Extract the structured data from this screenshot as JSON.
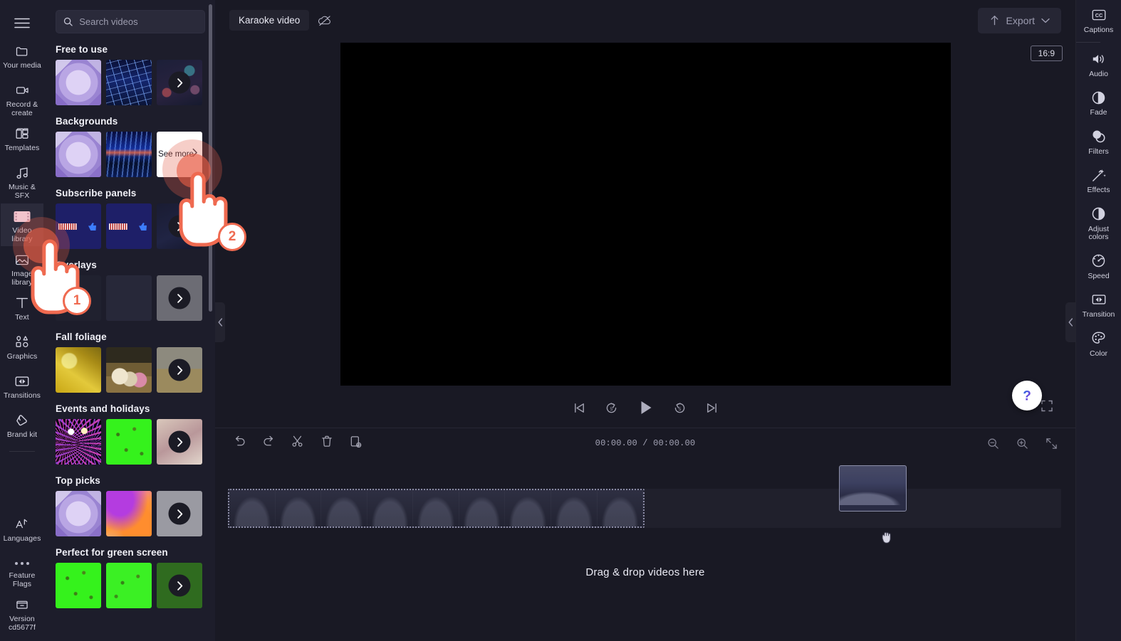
{
  "app": {
    "background_color": "#191924",
    "panel_color": "#1d1d2b",
    "accent_color": "#ef6a50"
  },
  "left_rail": {
    "hamburger_icon": "hamburger-menu-icon",
    "items": [
      {
        "label": "Your media",
        "icon": "folder-icon",
        "active": false
      },
      {
        "label": "Record & create",
        "icon": "video-camera-icon",
        "active": false
      },
      {
        "label": "Templates",
        "icon": "templates-grid-icon",
        "active": false
      },
      {
        "label": "Music & SFX",
        "icon": "music-note-icon",
        "active": false
      },
      {
        "label": "Video library",
        "icon": "film-strip-icon",
        "active": true
      },
      {
        "label": "Image library",
        "icon": "image-icon",
        "active": false
      },
      {
        "label": "Text",
        "icon": "text-t-icon",
        "active": false
      },
      {
        "label": "Graphics",
        "icon": "shapes-icon",
        "active": false
      },
      {
        "label": "Transitions",
        "icon": "transition-icon",
        "active": false
      },
      {
        "label": "Brand kit",
        "icon": "brand-kit-icon",
        "active": false
      }
    ],
    "bottom_items": [
      {
        "label": "Languages",
        "icon": "translate-icon"
      },
      {
        "label": "Feature Flags",
        "icon": "ellipsis-icon"
      },
      {
        "label": "Version cd5677f",
        "icon": "archive-box-icon"
      }
    ]
  },
  "library_panel": {
    "search": {
      "placeholder": "Search videos",
      "value": "",
      "icon": "search-icon"
    },
    "sections": [
      {
        "title": "Free to use",
        "thumbs": [
          {
            "name": "thumb-lilac-cubes",
            "art": "t-lilac",
            "kind": "image"
          },
          {
            "name": "thumb-blue-grid",
            "art": "t-grid",
            "kind": "image"
          },
          {
            "name": "thumb-bokeh-more",
            "art": "t-bokeh",
            "kind": "more-arrow"
          }
        ]
      },
      {
        "title": "Backgrounds",
        "thumbs": [
          {
            "name": "thumb-lilac-cubes",
            "art": "t-lilac",
            "kind": "image"
          },
          {
            "name": "thumb-blue-wave",
            "art": "t-wave",
            "kind": "image"
          },
          {
            "name": "thumb-see-more",
            "art": "t-white",
            "kind": "see-more",
            "label": "See more"
          }
        ]
      },
      {
        "title": "Subscribe panels",
        "thumbs": [
          {
            "name": "thumb-subscribe-1",
            "art": "t-sub",
            "kind": "image"
          },
          {
            "name": "thumb-subscribe-2",
            "art": "t-sub",
            "kind": "image"
          },
          {
            "name": "thumb-subscribe-more",
            "art": "t-dark",
            "kind": "more-arrow"
          }
        ]
      },
      {
        "title": "Overlays",
        "thumbs": [
          {
            "name": "thumb-overlay-1",
            "art": "t-ov1",
            "kind": "image"
          },
          {
            "name": "thumb-overlay-2",
            "art": "t-ov2",
            "kind": "image"
          },
          {
            "name": "thumb-overlay-more",
            "art": "t-grey",
            "kind": "more-arrow"
          }
        ]
      },
      {
        "title": "Fall foliage",
        "thumbs": [
          {
            "name": "thumb-yellow-leaves",
            "art": "t-fall1",
            "kind": "image"
          },
          {
            "name": "thumb-family-autumn",
            "art": "t-fall2",
            "kind": "image"
          },
          {
            "name": "thumb-fall-more",
            "art": "t-fall3",
            "kind": "more-arrow"
          }
        ]
      },
      {
        "title": "Events and holidays",
        "thumbs": [
          {
            "name": "thumb-fireworks",
            "art": "t-fire",
            "kind": "image"
          },
          {
            "name": "thumb-green-screen-confetti",
            "art": "t-green",
            "kind": "image"
          },
          {
            "name": "thumb-events-more",
            "art": "t-event3",
            "kind": "more-arrow"
          }
        ]
      },
      {
        "title": "Top picks",
        "thumbs": [
          {
            "name": "thumb-lilac-cubes",
            "art": "t-lilac",
            "kind": "image"
          },
          {
            "name": "thumb-orange-gradient",
            "art": "t-orange",
            "kind": "image"
          },
          {
            "name": "thumb-top-picks-more",
            "art": "t-lightgrey",
            "kind": "more-arrow"
          }
        ]
      },
      {
        "title": "Perfect for green screen",
        "thumbs": [
          {
            "name": "thumb-green-confetti-1",
            "art": "t-green",
            "kind": "image"
          },
          {
            "name": "thumb-green-confetti-2",
            "art": "t-green2",
            "kind": "image"
          },
          {
            "name": "thumb-green-more",
            "art": "t-greendark",
            "kind": "more-arrow"
          }
        ]
      }
    ]
  },
  "topbar": {
    "project_title": "Karaoke video",
    "cloud_icon": "cloud-offline-icon",
    "export_label": "Export",
    "export_icon": "upload-arrow-icon",
    "export_chevron": "chevron-down-icon"
  },
  "preview": {
    "aspect_ratio": "16:9",
    "controls": [
      {
        "name": "skip-to-start-button",
        "icon": "skip-back-icon"
      },
      {
        "name": "rewind-5s-button",
        "icon": "rewind-5-icon"
      },
      {
        "name": "play-button",
        "icon": "play-icon"
      },
      {
        "name": "forward-5s-button",
        "icon": "forward-5-icon"
      },
      {
        "name": "skip-to-end-button",
        "icon": "skip-forward-icon"
      }
    ],
    "fullscreen_icon": "fullscreen-icon",
    "help_icon": "help-question-icon"
  },
  "timeline": {
    "tools": [
      {
        "name": "undo-button",
        "icon": "undo-icon"
      },
      {
        "name": "redo-button",
        "icon": "redo-icon"
      },
      {
        "name": "split-button",
        "icon": "scissors-icon"
      },
      {
        "name": "delete-button",
        "icon": "trash-icon"
      },
      {
        "name": "duplicate-button",
        "icon": "duplicate-icon"
      }
    ],
    "current_time": "00:00.00",
    "total_time": "00:00.00",
    "time_separator": "/",
    "zoom_out_icon": "zoom-out-icon",
    "zoom_in_icon": "zoom-in-icon",
    "fit-icon": "fit-to-screen-icon",
    "drop_hint": "Drag & drop videos here",
    "drag_cursor_icon": "grabbing-hand-icon"
  },
  "right_rail": {
    "items": [
      {
        "label": "Captions",
        "icon": "closed-captions-icon"
      },
      {
        "label": "Audio",
        "icon": "speaker-icon"
      },
      {
        "label": "Fade",
        "icon": "fade-circle-icon"
      },
      {
        "label": "Filters",
        "icon": "filters-overlap-icon"
      },
      {
        "label": "Effects",
        "icon": "magic-wand-icon"
      },
      {
        "label": "Adjust colors",
        "icon": "contrast-circle-icon"
      },
      {
        "label": "Speed",
        "icon": "speedometer-icon"
      },
      {
        "label": "Transition",
        "icon": "transition-icon"
      },
      {
        "label": "Color",
        "icon": "palette-icon"
      }
    ]
  },
  "annotations": [
    {
      "number": "1",
      "target": "Video library rail item",
      "icon": "pointing-hand-icon"
    },
    {
      "number": "2",
      "target": "See more button in Backgrounds",
      "icon": "pointing-hand-icon"
    }
  ],
  "collapse": {
    "left_icon": "chevron-left-icon",
    "right_icon": "chevron-left-icon"
  }
}
